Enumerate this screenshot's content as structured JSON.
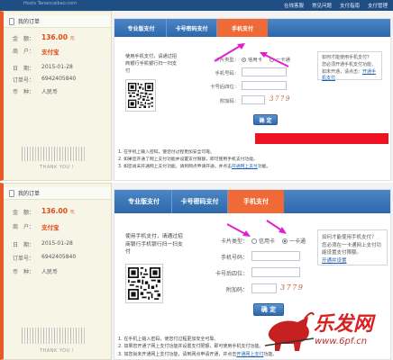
{
  "topbar": {
    "site_name": "Hosts Tanancaibao.com",
    "links": [
      "在线客服",
      "常见问题",
      "支付指南",
      "支付管理"
    ]
  },
  "order_labels": {
    "title": "我的订单",
    "amount": "金　额：",
    "merchant": "商　户：",
    "date": "日　期：",
    "order_no": "订单号：",
    "currency": "币　种："
  },
  "order": {
    "amount": "136.00",
    "amount_unit": "元",
    "merchant": "支付宝",
    "date": "2015-01-28",
    "order_no": "6942405840",
    "currency": "人民币",
    "thanks": "THANK YOU !"
  },
  "tabs": [
    "专业版支付",
    "卡号密码支付",
    "手机支付"
  ],
  "active_tab": "手机支付",
  "phone_pay": {
    "tip": "使用手机支付，请通过招商银行手机银行扫一扫支付",
    "card_type_label": "卡片类型：",
    "credit_card": "信用卡",
    "debit_card": "一卡通",
    "phone_label": "手机号码：",
    "last4_label": "卡号后四位：",
    "extra_label": "附加码：",
    "captcha": "3779",
    "submit": "确 定"
  },
  "notice": {
    "line1": "如何才能使用手机支付？",
    "line2": "您必须开通手机支付功能，",
    "line3": "如未开通，请点击：",
    "link": "开通手机支付"
  },
  "notice2": {
    "line1": "如何才能使用手机支付？",
    "line2": "您必须在一卡通网上支付功能设置支付限额。",
    "link": "开通并设置"
  },
  "notes": {
    "n1": "1. 在手机上输入密码，使您付过程更加安全可靠。",
    "n2": "2. 如果您开通了网上支付功能并设置支付限额，即可使用手机支付功能。",
    "n3": "3. 如您尚未开通网上支付功能，请到网点申请开通，并点击",
    "n3_link": "开通网上支付",
    "n3_tail": "功能。"
  },
  "watermark": {
    "title": "乐发网",
    "url": "www.6pf.cn"
  },
  "colors": {
    "tab_active": "#f06a38",
    "tab_bar": "#2d68ab",
    "amount": "#e04a18",
    "red_bar": "#ee1322",
    "arrow": "#e020d0"
  }
}
